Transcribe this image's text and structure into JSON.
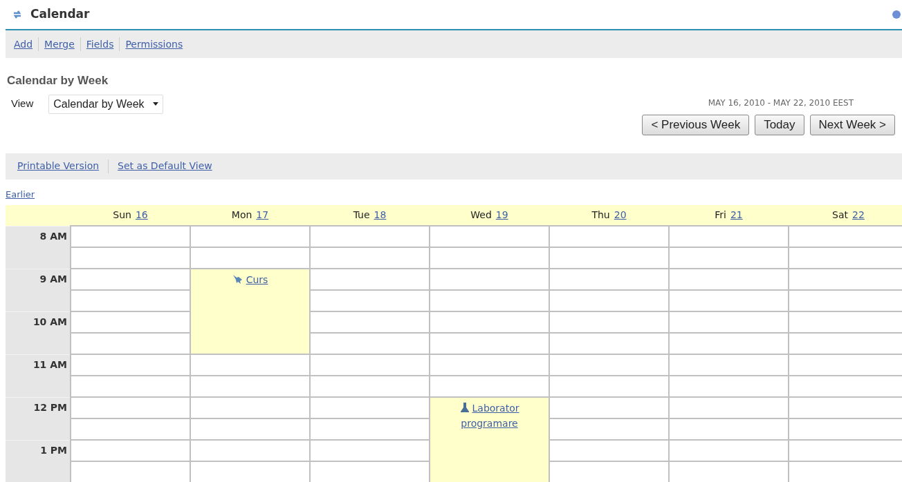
{
  "title": "Calendar",
  "toolbar": [
    "Add",
    "Merge",
    "Fields",
    "Permissions"
  ],
  "heading": "Calendar by Week",
  "view": {
    "label": "View",
    "value": "Calendar by Week"
  },
  "date_range": "MAY 16, 2010 - MAY 22, 2010 EEST",
  "nav_buttons": [
    "< Previous Week",
    "Today",
    "Next Week >"
  ],
  "view_links": [
    "Printable Version",
    "Set as Default View"
  ],
  "earlier_link": "Earlier",
  "hours": [
    "8 AM",
    "9 AM",
    "10 AM",
    "11 AM",
    "12 PM",
    "1 PM"
  ],
  "days": [
    {
      "name": "Sun",
      "date": "16"
    },
    {
      "name": "Mon",
      "date": "17",
      "busy": [
        false,
        false,
        true,
        true,
        true,
        true,
        false,
        false,
        false,
        false,
        false,
        false
      ],
      "events": [
        {
          "title": "Curs",
          "kind": "pin"
        }
      ]
    },
    {
      "name": "Tue",
      "date": "18"
    },
    {
      "name": "Wed",
      "date": "19",
      "busy": [
        false,
        false,
        false,
        false,
        false,
        false,
        false,
        false,
        true,
        true,
        true,
        true
      ],
      "events": [
        {
          "title": "Laborator programare",
          "kind": "flask"
        }
      ]
    },
    {
      "name": "Thu",
      "date": "20"
    },
    {
      "name": "Fri",
      "date": "21"
    },
    {
      "name": "Sat",
      "date": "22"
    }
  ]
}
